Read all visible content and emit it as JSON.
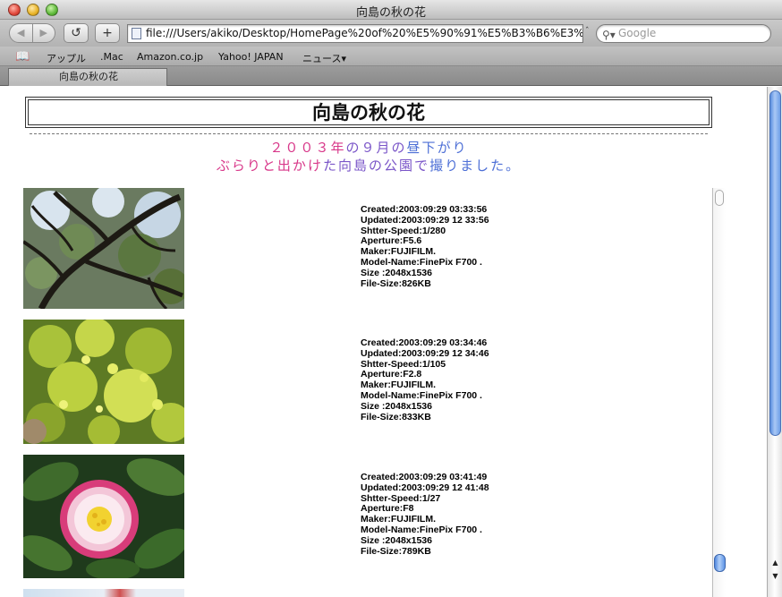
{
  "window": {
    "title": "向島の秋の花"
  },
  "toolbar": {
    "back_label": "◀",
    "forward_label": "▶",
    "reload_label": "↺",
    "add_label": "+",
    "url": "file:///Users/akiko/Desktop/HomePage%20of%20%E5%90%91%E5%B3%B6%E3%81%A",
    "url_overflow": "ˆ",
    "search_placeholder": "Google"
  },
  "bookmarks": [
    "アップル",
    ".Mac",
    "Amazon.co.jp",
    "Yahoo! JAPAN",
    "ニュース▾"
  ],
  "tab": {
    "label": "向島の秋の花"
  },
  "page": {
    "title": "向島の秋の花",
    "subtitle_1": "２００３年の９月の昼下がり",
    "subtitle_2": "ぶらりと出かけた向島の公園で撮りました。"
  },
  "photos": [
    {
      "subject": "tree-canopy",
      "meta": [
        "Created:2003:09:29 03:33:56",
        "Updated:2003:09:29 12 33:56",
        "Shtter-Speed:1/280",
        "Aperture:F5.6",
        "Maker:FUJIFILM.",
        "Model-Name:FinePix F700 .",
        "Size :2048x1536",
        "File-Size:826KB"
      ]
    },
    {
      "subject": "yellow-flowers",
      "meta": [
        "Created:2003:09:29 03:34:46",
        "Updated:2003:09:29 12 34:46",
        "Shtter-Speed:1/105",
        "Aperture:F2.8",
        "Maker:FUJIFILM.",
        "Model-Name:FinePix F700 .",
        "Size :2048x1536",
        "File-Size:833KB"
      ]
    },
    {
      "subject": "camellia",
      "meta": [
        "Created:2003:09:29 03:41:49",
        "Updated:2003:09:29 12 41:48",
        "Shtter-Speed:1/27",
        "Aperture:F8",
        "Maker:FUJIFILM.",
        "Model-Name:FinePix F700 .",
        "Size :2048x1536",
        "File-Size:789KB"
      ]
    }
  ],
  "colors": {
    "pink": "#d8388a",
    "purple": "#7a55c8",
    "blue": "#4d6fd6"
  }
}
